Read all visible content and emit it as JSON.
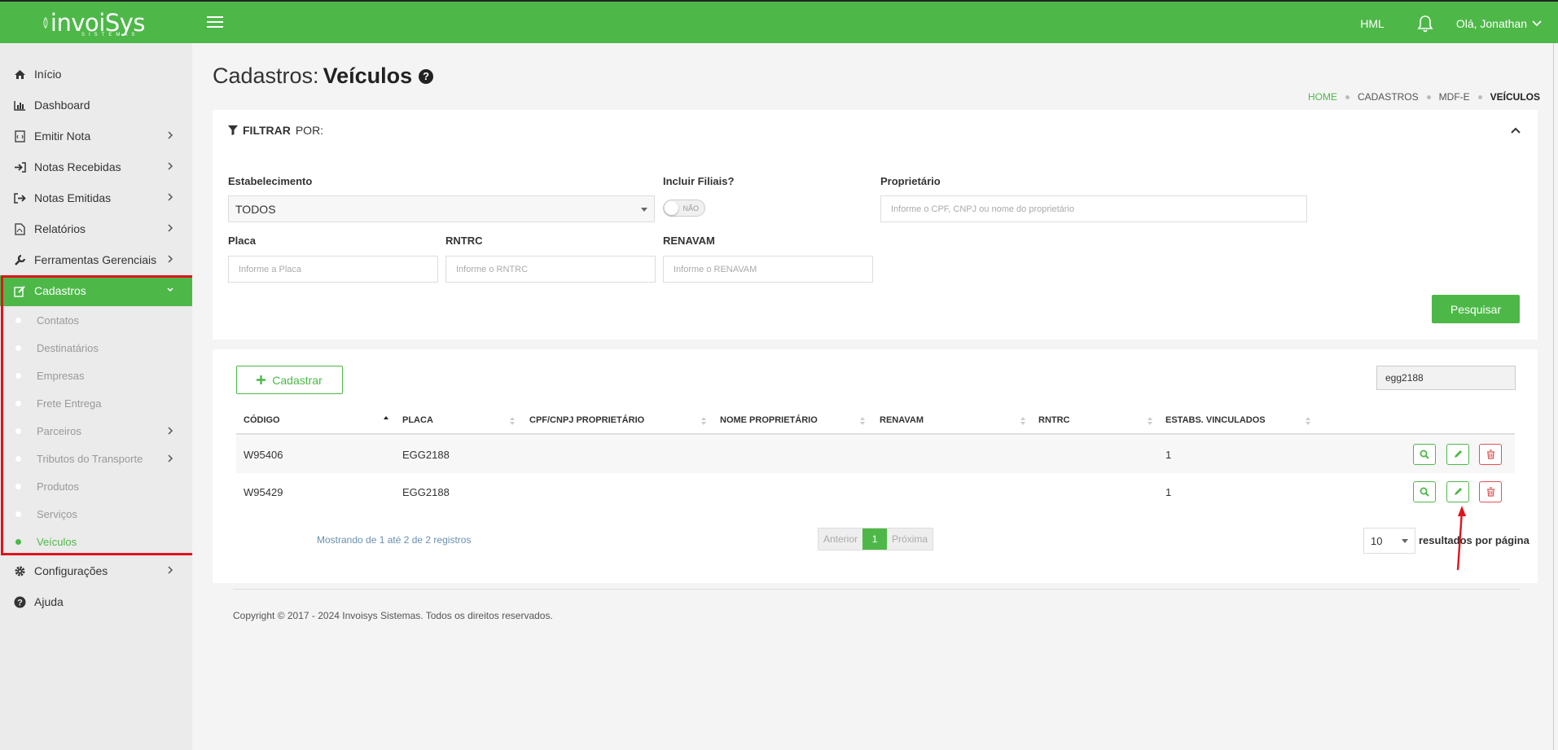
{
  "header": {
    "brand": "invoiSys",
    "brand_sub": "SISTEMAS",
    "env": "HML",
    "user_greeting": "Olá, Jonathan"
  },
  "sidebar": {
    "items": [
      {
        "label": "Início",
        "icon": "home-icon"
      },
      {
        "label": "Dashboard",
        "icon": "bar-chart-icon"
      },
      {
        "label": "Emitir Nota",
        "icon": "file-code-icon"
      },
      {
        "label": "Notas Recebidas",
        "icon": "sign-in-icon"
      },
      {
        "label": "Notas Emitidas",
        "icon": "sign-out-icon"
      },
      {
        "label": "Relatórios",
        "icon": "file-pdf-icon"
      },
      {
        "label": "Ferramentas Gerenciais",
        "icon": "wrench-icon"
      },
      {
        "label": "Cadastros",
        "icon": "edit-icon"
      },
      {
        "label": "Configurações",
        "icon": "gear-icon"
      },
      {
        "label": "Ajuda",
        "icon": "question-circle-icon"
      }
    ],
    "cadastros_sub": [
      "Contatos",
      "Destinatários",
      "Empresas",
      "Frete Entrega",
      "Parceiros",
      "Tributos do Transporte",
      "Produtos",
      "Serviços",
      "Veículos"
    ]
  },
  "page": {
    "title_prefix": "Cadastros:",
    "title": "Veículos",
    "help": "?",
    "breadcrumb": [
      "HOME",
      "CADASTROS",
      "MDF-E",
      "VEÍCULOS"
    ]
  },
  "filter": {
    "heading_bold": "FILTRAR",
    "heading_rest": "POR:",
    "estabelecimento_label": "Estabelecimento",
    "estabelecimento_value": "TODOS",
    "filiais_label": "Incluir Filiais?",
    "filiais_toggle": "NÃO",
    "proprietario_label": "Proprietário",
    "proprietario_placeholder": "Informe o CPF, CNPJ ou nome do proprietário",
    "placa_label": "Placa",
    "placa_placeholder": "Informe a Placa",
    "rntrc_label": "RNTRC",
    "rntrc_placeholder": "Informe o RNTRC",
    "renavam_label": "RENAVAM",
    "renavam_placeholder": "Informe o RENAVAM",
    "search_button": "Pesquisar"
  },
  "list": {
    "add_button": "Cadastrar",
    "search_value": "egg2188",
    "columns": [
      "CÓDIGO",
      "PLACA",
      "CPF/CNPJ PROPRIETÁRIO",
      "NOME PROPRIETÁRIO",
      "RENAVAM",
      "RNTRC",
      "ESTABS. VINCULADOS"
    ],
    "rows": [
      {
        "codigo": "W95406",
        "placa": "EGG2188",
        "cpf": "",
        "nome": "",
        "renavam": "",
        "rntrc": "",
        "estabs": "1"
      },
      {
        "codigo": "W95429",
        "placa": "EGG2188",
        "cpf": "",
        "nome": "",
        "renavam": "",
        "rntrc": "",
        "estabs": "1"
      }
    ],
    "info": "Mostrando de 1 até 2 de 2 registros",
    "pager": {
      "prev": "Anterior",
      "page": "1",
      "next": "Próxima"
    },
    "per_page_value": "10",
    "per_page_label": "resultados por página"
  },
  "footer": {
    "text": "Copyright © 2017 - 2024 Invoisys Sistemas. Todos os direitos reservados."
  },
  "colors": {
    "accent": "#4db848",
    "danger": "#e05252",
    "highlight": "#e0141e"
  }
}
